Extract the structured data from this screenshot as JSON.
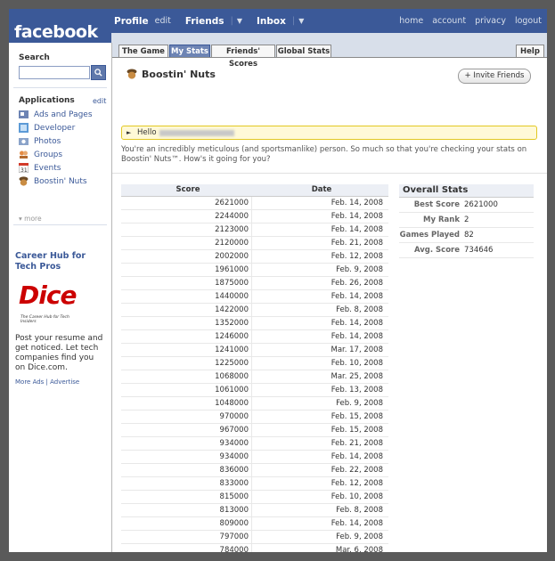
{
  "brand": "facebook",
  "topnav": {
    "profile": "Profile",
    "edit": "edit",
    "friends": "Friends",
    "inbox": "Inbox",
    "arrow": "▼",
    "right": [
      "home",
      "account",
      "privacy",
      "logout"
    ]
  },
  "sidebar": {
    "search_label": "Search",
    "search_btn": "🔍",
    "apps_title": "Applications",
    "apps_edit": "edit",
    "items": [
      {
        "label": "Ads and Pages",
        "icon": "ads-icon"
      },
      {
        "label": "Developer",
        "icon": "developer-icon"
      },
      {
        "label": "Photos",
        "icon": "photos-icon"
      },
      {
        "label": "Groups",
        "icon": "groups-icon"
      },
      {
        "label": "Events",
        "icon": "events-icon"
      },
      {
        "label": "Boostin' Nuts",
        "icon": "acorn-icon"
      }
    ],
    "more": "▾ more",
    "ad": {
      "title": "Career Hub for Tech Pros",
      "logo_word": "Dice",
      "logo_tag": "The Career Hub for Tech Insiders",
      "body": "Post your resume and get noticed. Let tech companies find you on Dice.com.",
      "links": "More Ads | Advertise"
    }
  },
  "tabs": [
    "The Game",
    "My Stats",
    "Friends' Scores",
    "Global Stats"
  ],
  "active_tab": "My Stats",
  "help_tab": "Help",
  "app": {
    "title": "Boostin' Nuts",
    "invite": "+ Invite Friends",
    "hello": "Hello",
    "hello_arrow": "►",
    "intro": "You're an incredibly meticulous (and sportsmanlike) person. So much so that you're checking your stats on Boostin' Nuts™. How's it going for you?"
  },
  "scores": {
    "headers": [
      "Score",
      "Date"
    ],
    "rows": [
      [
        "2621000",
        "Feb. 14, 2008"
      ],
      [
        "2244000",
        "Feb. 14, 2008"
      ],
      [
        "2123000",
        "Feb. 14, 2008"
      ],
      [
        "2120000",
        "Feb. 21, 2008"
      ],
      [
        "2002000",
        "Feb. 12, 2008"
      ],
      [
        "1961000",
        "Feb. 9, 2008"
      ],
      [
        "1875000",
        "Feb. 26, 2008"
      ],
      [
        "1440000",
        "Feb. 14, 2008"
      ],
      [
        "1422000",
        "Feb. 8, 2008"
      ],
      [
        "1352000",
        "Feb. 14, 2008"
      ],
      [
        "1246000",
        "Feb. 14, 2008"
      ],
      [
        "1241000",
        "Mar. 17, 2008"
      ],
      [
        "1225000",
        "Feb. 10, 2008"
      ],
      [
        "1068000",
        "Mar. 25, 2008"
      ],
      [
        "1061000",
        "Feb. 13, 2008"
      ],
      [
        "1048000",
        "Feb. 9, 2008"
      ],
      [
        "970000",
        "Feb. 15, 2008"
      ],
      [
        "967000",
        "Feb. 15, 2008"
      ],
      [
        "934000",
        "Feb. 21, 2008"
      ],
      [
        "934000",
        "Feb. 14, 2008"
      ],
      [
        "836000",
        "Feb. 22, 2008"
      ],
      [
        "833000",
        "Feb. 12, 2008"
      ],
      [
        "815000",
        "Feb. 10, 2008"
      ],
      [
        "813000",
        "Feb. 8, 2008"
      ],
      [
        "809000",
        "Feb. 14, 2008"
      ],
      [
        "797000",
        "Feb. 9, 2008"
      ],
      [
        "784000",
        "Mar. 6, 2008"
      ]
    ]
  },
  "overall": {
    "title": "Overall Stats",
    "rows": [
      [
        "Best Score",
        "2621000"
      ],
      [
        "My Rank",
        "2"
      ],
      [
        "Games Played",
        "82"
      ],
      [
        "Avg. Score",
        "734646"
      ]
    ]
  },
  "colors": {
    "brand_blue": "#3b5998",
    "tab_bar": "#d8dfea",
    "hello_bg": "#fff9d7",
    "dice_red": "#cc0000"
  }
}
